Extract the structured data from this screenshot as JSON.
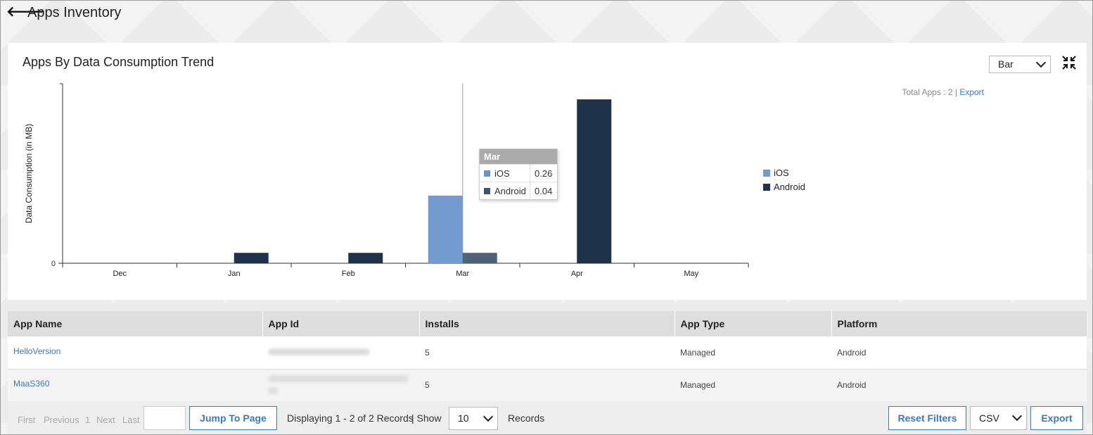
{
  "header": {
    "title": "Apps Inventory"
  },
  "chart_panel": {
    "title": "Apps By Data Consumption Trend",
    "chart_type_selected": "Bar",
    "total_apps_label": "Total Apps : 2 |",
    "export_link": "Export"
  },
  "chart_data": {
    "type": "bar",
    "title": "Apps By Data Consumption Trend",
    "xlabel": "",
    "ylabel": "Data Consumption (in MB)",
    "categories": [
      "Dec",
      "Jan",
      "Feb",
      "Mar",
      "Apr",
      "May"
    ],
    "series": [
      {
        "name": "iOS",
        "color": "#739bcf",
        "values": [
          0,
          0,
          0,
          0.26,
          0,
          0
        ]
      },
      {
        "name": "Android",
        "color": "#1e334a",
        "values": [
          0,
          0.04,
          0.04,
          0.04,
          0.63,
          0
        ]
      }
    ],
    "y_tick_labels": [
      "0"
    ],
    "ylim": [
      0,
      0.69
    ],
    "legend": "right",
    "grid": false
  },
  "tooltip": {
    "title": "Mar",
    "rows": [
      {
        "name": "iOS",
        "value": "0.26",
        "color": "#6d92c6"
      },
      {
        "name": "Android",
        "value": "0.04",
        "color": "#3f5469"
      }
    ]
  },
  "table": {
    "columns": [
      "App Name",
      "App Id",
      "Installs",
      "App Type",
      "Platform"
    ],
    "rows": [
      {
        "app_name": "HelloVersion",
        "installs": "5",
        "app_type": "Managed",
        "platform": "Android"
      },
      {
        "app_name": "MaaS360",
        "installs": "5",
        "app_type": "Managed",
        "platform": "Android"
      }
    ]
  },
  "pager": {
    "first": "First",
    "previous": "Previous",
    "page": "1",
    "next": "Next",
    "last": "Last",
    "jump_button": "Jump To Page",
    "displaying": "Displaying 1 - 2 of 2 Records",
    "show": "| Show",
    "page_size": "10",
    "records": "Records",
    "reset_button": "Reset Filters",
    "export_format": "CSV",
    "export_button": "Export"
  }
}
